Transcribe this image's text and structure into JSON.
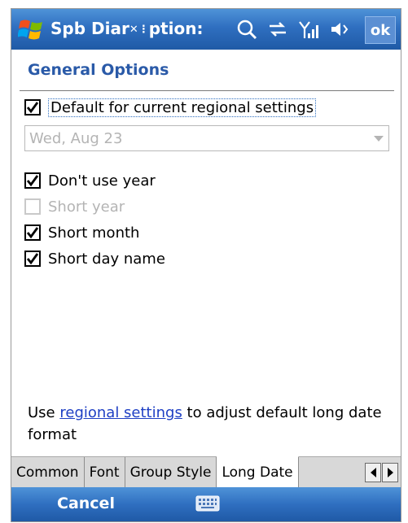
{
  "titlebar": {
    "title": "Spb Diar",
    "title_tail": "ption",
    "ok_label": "ok"
  },
  "heading": "General Options",
  "options": {
    "default_regional": {
      "label": "Default for current regional settings",
      "checked": true
    },
    "date_combo": {
      "value": "Wed, Aug 23"
    },
    "dont_use_year": {
      "label": "Don't use year",
      "checked": true
    },
    "short_year": {
      "label": "Short year",
      "checked": false,
      "disabled": true
    },
    "short_month": {
      "label": "Short month",
      "checked": true
    },
    "short_day_name": {
      "label": "Short day name",
      "checked": true
    }
  },
  "note": {
    "prefix": "Use ",
    "link": "regional settings",
    "suffix": " to adjust default long date format"
  },
  "tabs": [
    "Common",
    "Font",
    "Group Style",
    "Long Date"
  ],
  "active_tab": "Long Date",
  "menubar": {
    "cancel_label": "Cancel"
  },
  "colors": {
    "titlebar": "#2f6fc0",
    "heading": "#2a5aa8",
    "link": "#1e3fc4"
  },
  "icons": [
    "windows-start-icon",
    "search-icon",
    "connectivity-icon",
    "signal-icon",
    "volume-icon",
    "keyboard-icon"
  ]
}
